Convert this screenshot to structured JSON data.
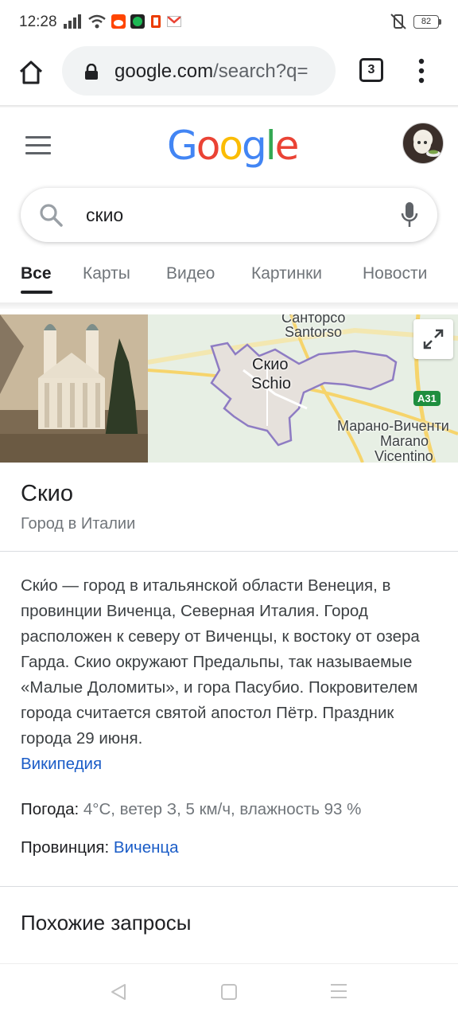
{
  "status_bar": {
    "time": "12:28",
    "battery": "82",
    "icons_left": [
      "signal-icon",
      "wifi-icon",
      "reddit-icon",
      "spotify-icon",
      "office-icon",
      "gmail-icon"
    ],
    "icons_right": [
      "vibrate-off-icon",
      "battery-icon"
    ]
  },
  "browser": {
    "url_host": "google.com",
    "url_path": "/search?q=",
    "tab_count": "3"
  },
  "google": {
    "logo_letters": [
      {
        "ch": "G",
        "color": "#4285F4"
      },
      {
        "ch": "o",
        "color": "#EA4335"
      },
      {
        "ch": "o",
        "color": "#FBBC05"
      },
      {
        "ch": "g",
        "color": "#4285F4"
      },
      {
        "ch": "l",
        "color": "#34A853"
      },
      {
        "ch": "e",
        "color": "#EA4335"
      }
    ]
  },
  "search": {
    "query": "скио"
  },
  "tabs": [
    "Все",
    "Карты",
    "Видео",
    "Картинки",
    "Новости"
  ],
  "map": {
    "labels": {
      "santorso_ru": "Санторсо",
      "santorso": "Santorso",
      "city_ru": "Скио",
      "city": "Schio",
      "marano_ru": "Марано-Виченти",
      "marano": "Marano",
      "vicentino": "Vicentino",
      "road": "A31"
    }
  },
  "knowledge_panel": {
    "title": "Скио",
    "subtitle": "Город в Италии",
    "description": "Ски́о — город в итальянской области Венеция, в провинции Виченца, Северная Италия. Город расположен к северу от Виченцы, к востоку от озера Гарда. Скио окружают Предальпы, так называемые «Малые Доломиты», и гора Пасубио. Покровителем города считается святой апостол Пётр. Праздник города 29 июня.",
    "source_link": "Википедия",
    "weather_label": "Погода:",
    "weather_value": "4°C, ветер З, 5 км/ч, влажность 93 %",
    "province_label": "Провинция:",
    "province_value": "Виченца"
  },
  "related": {
    "title": "Похожие запросы"
  },
  "colors": {
    "link": "#1a5cc7",
    "map_boundary": "#8e7cc3",
    "map_road": "#f6d46b"
  }
}
